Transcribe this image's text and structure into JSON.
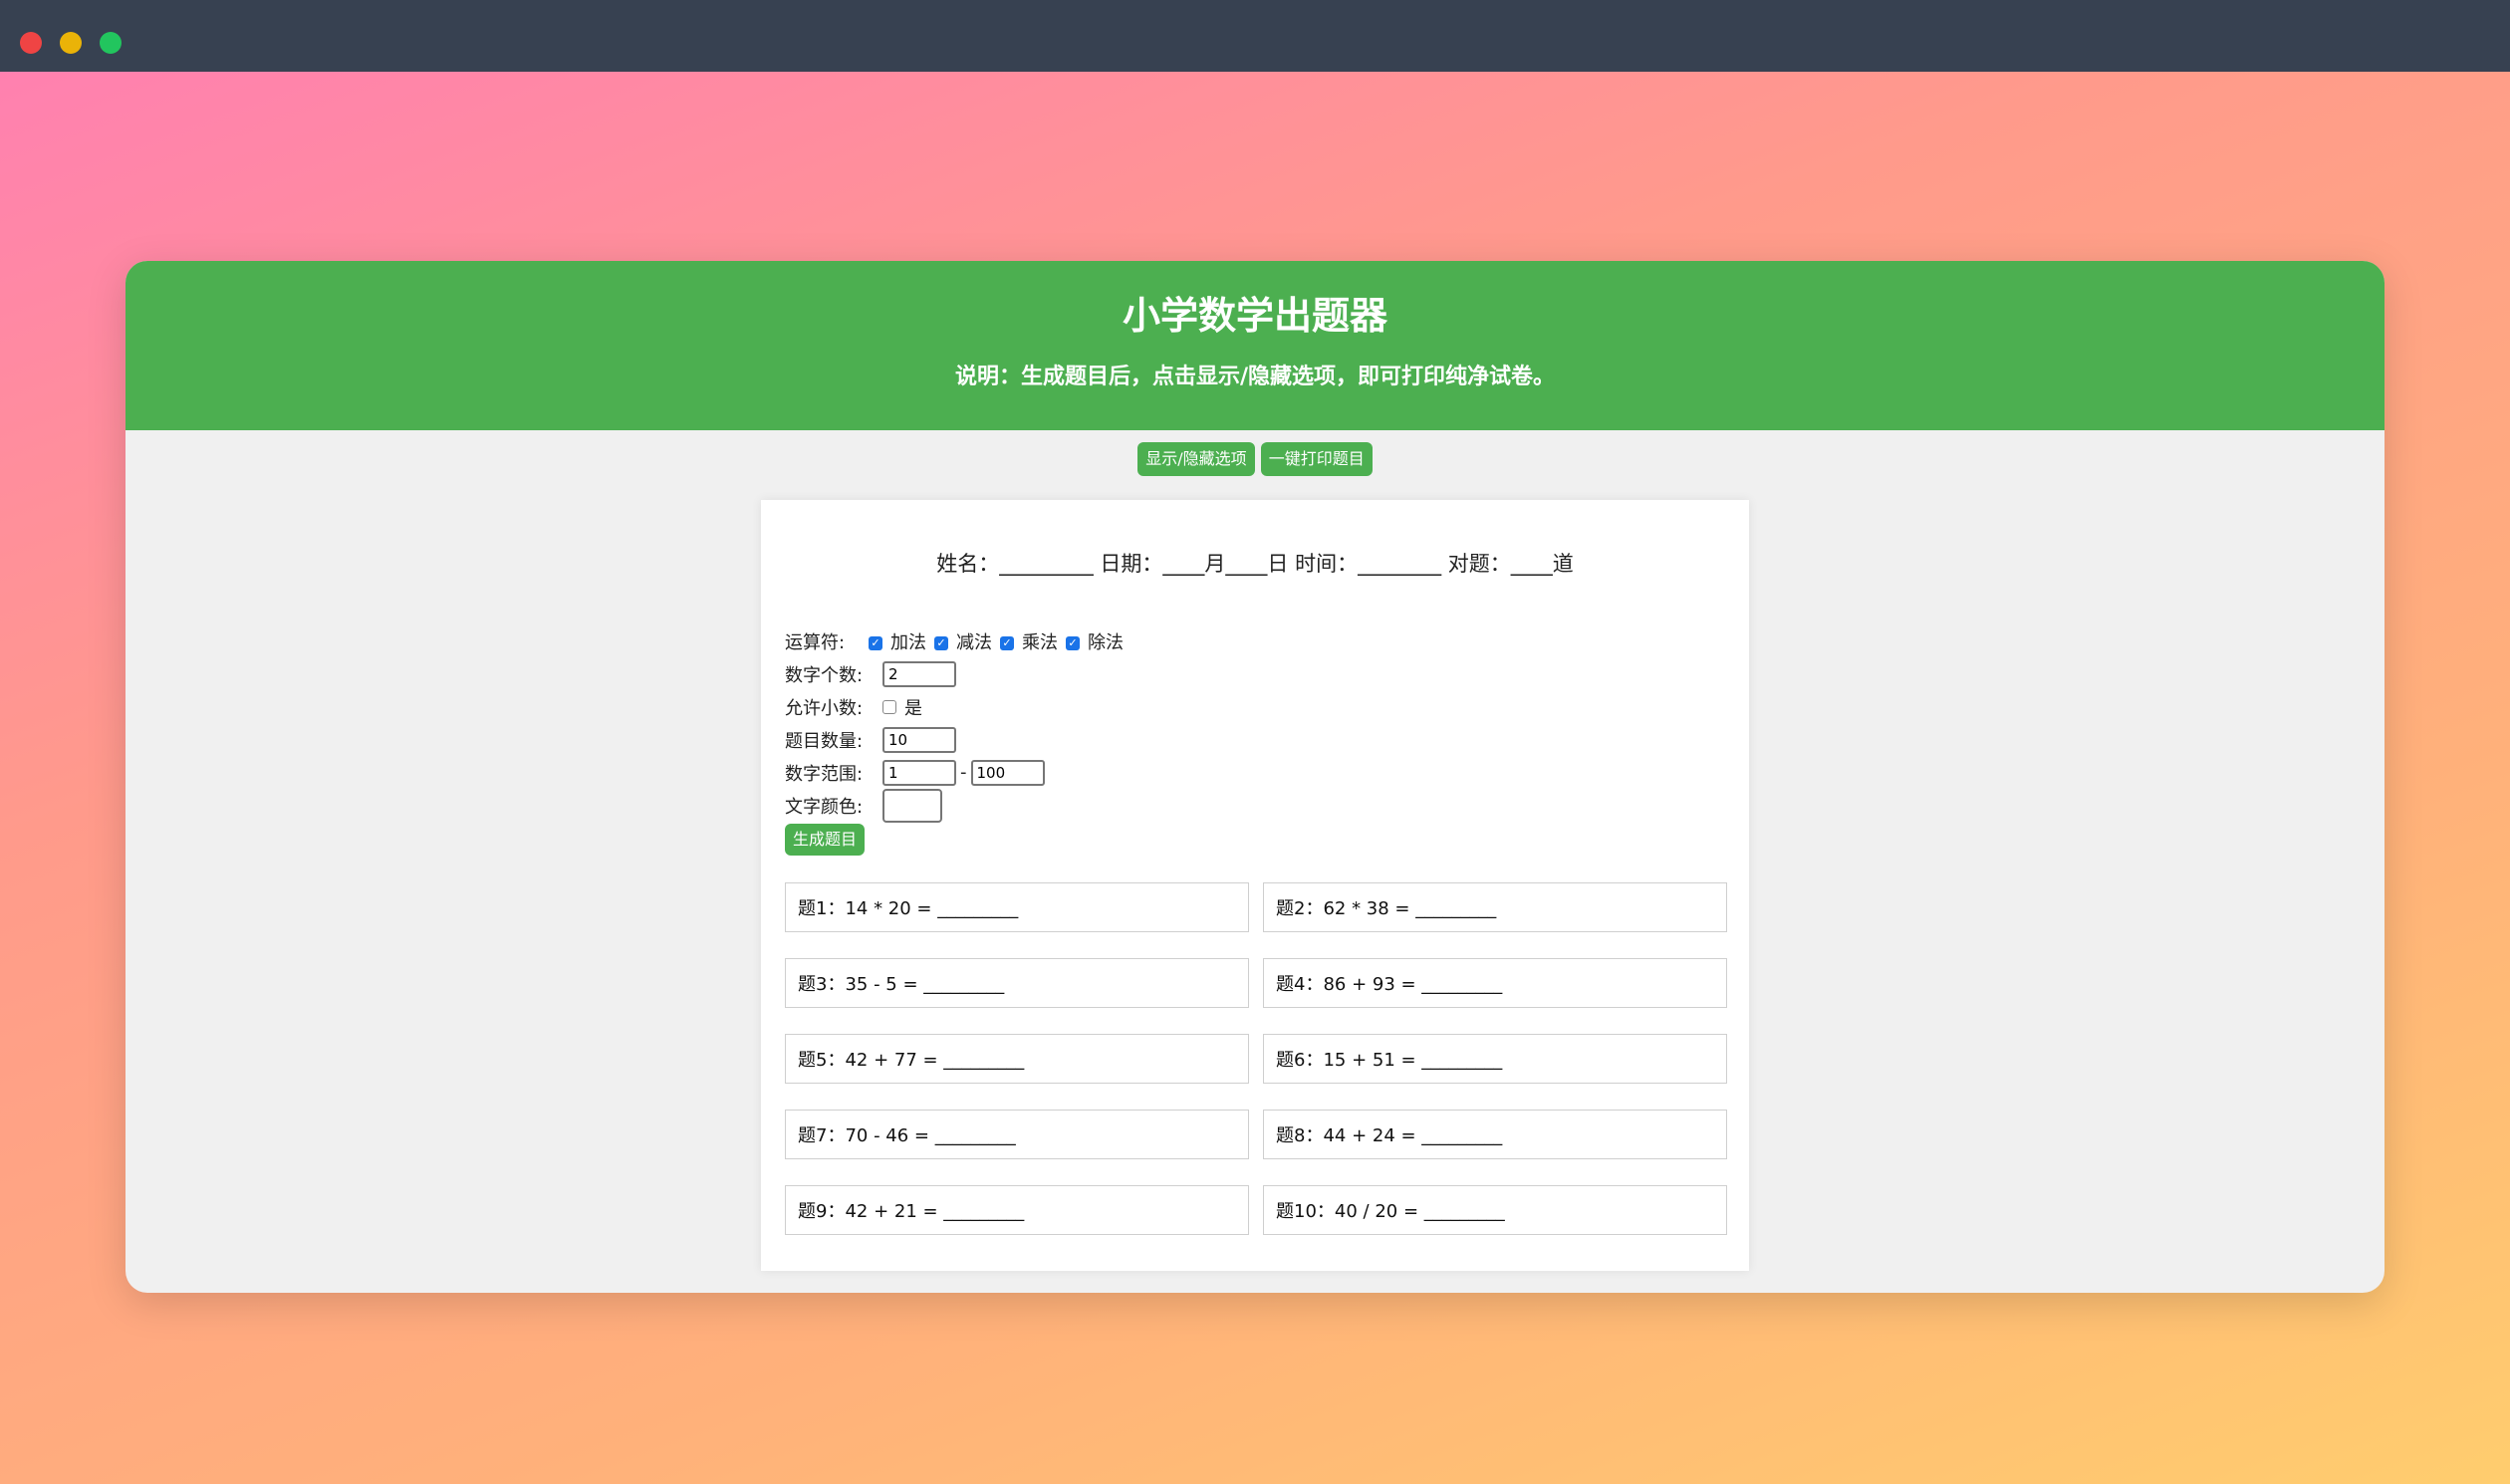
{
  "window_controls": {
    "close_icon": "close-dot",
    "minimize_icon": "minimize-dot",
    "zoom_icon": "zoom-dot"
  },
  "header": {
    "title": "小学数学出题器",
    "note": "说明：生成题目后，点击显示/隐藏选项，即可打印纯净试卷。"
  },
  "toolbar": {
    "toggle_label": "显示/隐藏选项",
    "print_label": "一键打印题目"
  },
  "info_line": "姓名：_________ 日期：____月____日 时间：________ 对题：____道",
  "options": {
    "operators_label": "运算符:",
    "operators": [
      {
        "label": "加法",
        "checked": true
      },
      {
        "label": "减法",
        "checked": true
      },
      {
        "label": "乘法",
        "checked": true
      },
      {
        "label": "除法",
        "checked": true
      }
    ],
    "num_count_label": "数字个数:",
    "num_count_value": "2",
    "allow_decimal_label": "允许小数:",
    "allow_decimal_option": "是",
    "allow_decimal_checked": false,
    "question_count_label": "题目数量:",
    "question_count_value": "10",
    "range_label": "数字范围:",
    "range_min": "1",
    "range_sep": "-",
    "range_max": "100",
    "text_color_label": "文字颜色:",
    "text_color_value": "#000000",
    "generate_label": "生成题目"
  },
  "questions": [
    "题1：14 * 20 = _________",
    "题2：62 * 38 = _________",
    "题3：35 - 5 = _________",
    "题4：86 + 93 = _________",
    "题5：42 + 77 = _________",
    "题6：15 + 51 = _________",
    "题7：70 - 46 = _________",
    "题8：44 + 24 = _________",
    "题9：42 + 21 = _________",
    "题10：40 / 20 = _________"
  ],
  "colors": {
    "accent": "#4caf50",
    "titlebar": "#374151",
    "checkbox": "#1a73e8"
  }
}
